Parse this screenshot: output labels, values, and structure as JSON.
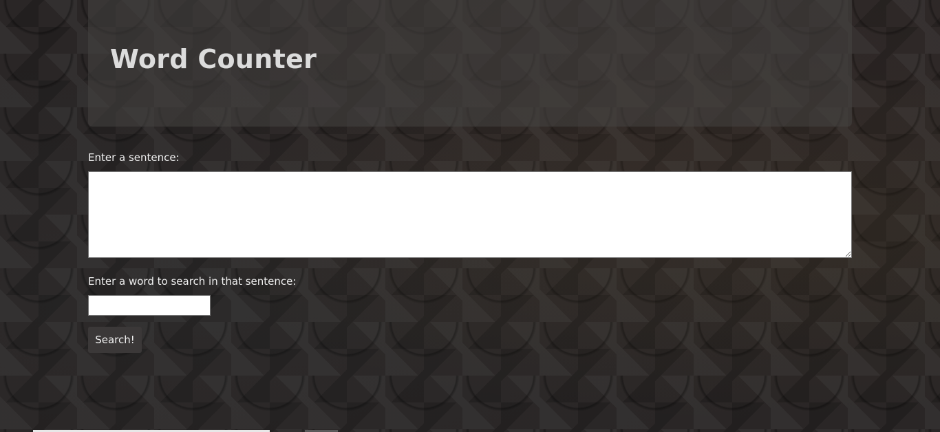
{
  "header": {
    "title": "Word Counter"
  },
  "form": {
    "sentence_label": "Enter a sentence:",
    "sentence_value": "",
    "word_label": "Enter a word to search in that sentence:",
    "word_value": "",
    "search_button_label": "Search!"
  },
  "colors": {
    "header_panel": "#46434299",
    "button_bg": "#3b3838",
    "title_text": "#dcdcdc"
  }
}
